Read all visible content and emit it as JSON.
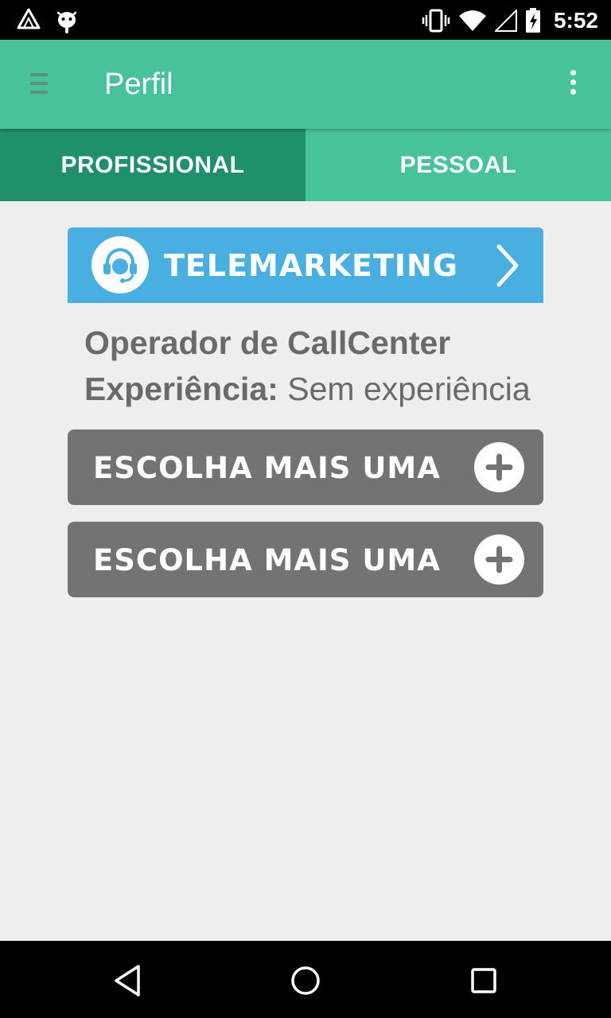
{
  "status_bar": {
    "time": "5:52",
    "icons": [
      "notification-triangle-icon",
      "android-icon",
      "vibrate-icon",
      "wifi-icon",
      "signal-icon",
      "battery-charging-icon"
    ]
  },
  "app_bar": {
    "title": "Perfil",
    "menu_icon": "hamburger-menu-icon",
    "overflow_icon": "more-vertical-icon"
  },
  "tabs": [
    {
      "label": "PROFISSIONAL",
      "active": true
    },
    {
      "label": "PESSOAL",
      "active": false
    }
  ],
  "profile": {
    "category": {
      "label": "TELEMARKETING",
      "icon": "headset-icon",
      "chevron_icon": "chevron-right-icon"
    },
    "job_title": "Operador de CallCenter",
    "experience_label": "Experiência:",
    "experience_value": "Sem experiência",
    "add_buttons": [
      {
        "label": "ESCOLHA MAIS UMA",
        "icon": "plus-circle-icon"
      },
      {
        "label": "ESCOLHA MAIS UMA",
        "icon": "plus-circle-icon"
      }
    ]
  },
  "nav_bar": {
    "buttons": [
      "back-icon",
      "home-icon",
      "recents-icon"
    ]
  },
  "colors": {
    "app_bar": "#47c29a",
    "active_tab": "#1f8f6c",
    "category_card": "#49aee0",
    "add_button": "#737373",
    "background": "#eeeeee"
  }
}
